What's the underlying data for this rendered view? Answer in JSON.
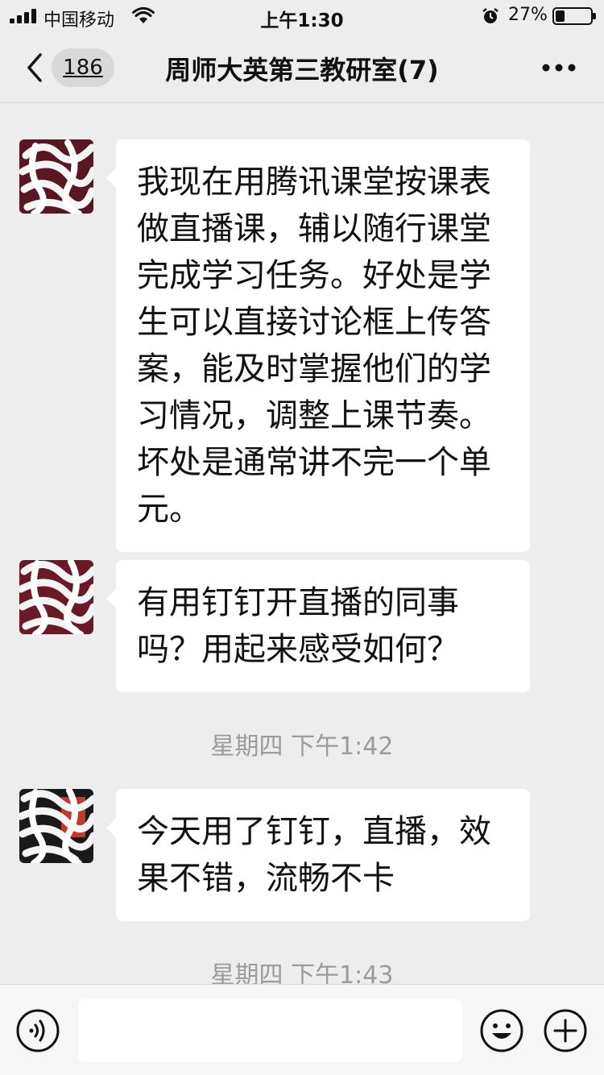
{
  "status_bar": {
    "carrier": "中国移动",
    "time": "上午1:30",
    "battery_percent": "27%",
    "battery_level": 0.27,
    "icons": [
      "signal-icon",
      "wifi-icon",
      "alarm-icon",
      "battery-icon"
    ]
  },
  "nav": {
    "back_icon": "chevron-left-icon",
    "unread_count": "186",
    "title": "周师大英第三教研室(7)",
    "more_icon": "more-dots-icon"
  },
  "messages": [
    {
      "type": "text",
      "side": "left",
      "text": "我现在用腾讯课堂按课表做直播课，辅以随行课堂完成学习任务。好处是学生可以直接讨论框上传答案，能及时掌握他们的学习情况，调整上课节奏。坏处是通常讲不完一个单元。"
    },
    {
      "type": "text",
      "side": "left",
      "text": "有用钉钉开直播的同事吗？用起来感受如何？"
    },
    {
      "type": "time",
      "text": "星期四 下午1:42"
    },
    {
      "type": "text",
      "side": "left",
      "text": "今天用了钉钉，直播，效果不错，流畅不卡"
    },
    {
      "type": "time",
      "text": "星期四 下午1:43"
    }
  ],
  "input_bar": {
    "placeholder": "",
    "value": "",
    "icons": [
      "voice-icon",
      "emoji-icon",
      "plus-icon"
    ]
  },
  "colors": {
    "background": "#ededed",
    "bubble": "#ffffff",
    "timestamp": "#9b9b9b",
    "badge": "#d8d8d8"
  }
}
